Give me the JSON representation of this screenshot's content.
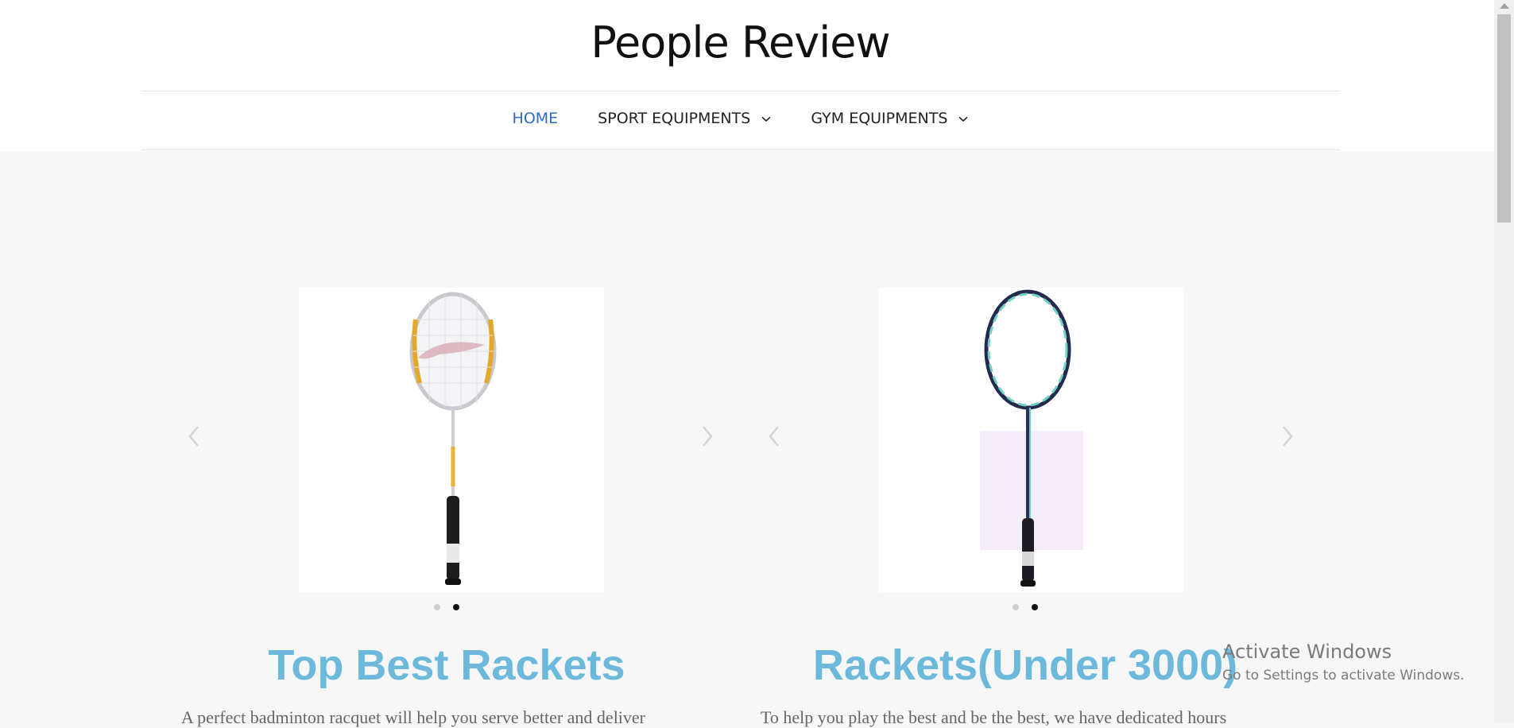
{
  "site": {
    "title": "People Review"
  },
  "nav": [
    {
      "label": "HOME",
      "active": true,
      "dropdown": false
    },
    {
      "label": "SPORT EQUIPMENTS",
      "active": false,
      "dropdown": true
    },
    {
      "label": "GYM EQUIPMENTS",
      "active": false,
      "dropdown": true
    }
  ],
  "cards": [
    {
      "title": "Top Best Rackets",
      "description": "A perfect badminton racquet will help you serve better and deliver",
      "slider": {
        "slide_count": 2,
        "active_index": 1,
        "image": "badminton-racket-yellow-white"
      }
    },
    {
      "title": "Rackets(Under 3000)",
      "description": "To help you play the best and be the best, we have dedicated hours",
      "slider": {
        "slide_count": 2,
        "active_index": 1,
        "image": "badminton-racket-navy-teal"
      }
    }
  ],
  "icons": {
    "prev": "chevron-left-icon",
    "next": "chevron-right-icon",
    "dropdown": "chevron-down-icon"
  },
  "watermark": {
    "line1": "Activate Windows",
    "line2": "Go to Settings to activate Windows."
  },
  "colors": {
    "accent_link": "#2d6bc9",
    "card_title": "#6cb9dc",
    "background": "#f7f7f7"
  }
}
